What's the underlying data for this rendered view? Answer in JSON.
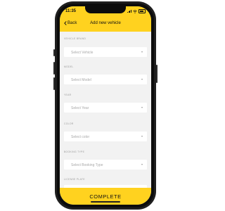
{
  "status_bar": {
    "time": "11:35"
  },
  "nav": {
    "back_label": "Back",
    "title": "Add new vehicle"
  },
  "form": {
    "fields": [
      {
        "label": "VEHICLE BRAND",
        "placeholder": "Select Vehicle"
      },
      {
        "label": "MODEL",
        "placeholder": "Select Model"
      },
      {
        "label": "YEAR",
        "placeholder": "Select Year"
      },
      {
        "label": "COLOR",
        "placeholder": "Select color"
      },
      {
        "label": "BOOKING TYPE",
        "placeholder": "Select Booking Type"
      },
      {
        "label": "LICENSE PLATE",
        "placeholder": ""
      }
    ]
  },
  "footer": {
    "complete_label": "COMPLETE"
  },
  "colors": {
    "accent": "#ffd21f",
    "background": "#f2f2f2"
  },
  "icons": [
    "back-chevron-icon",
    "signal-icon",
    "wifi-icon",
    "battery-icon",
    "dropdown-caret-icon"
  ]
}
